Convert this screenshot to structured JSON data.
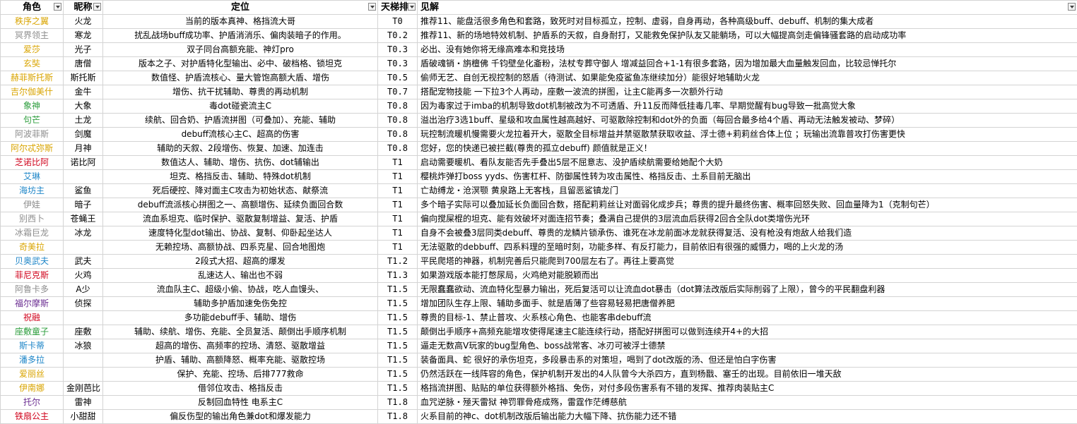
{
  "headers": [
    "角色",
    "昵称",
    "定位",
    "天梯排",
    "见解"
  ],
  "rows": [
    {
      "name": "秩序之翼",
      "color": "#d9a400",
      "nick": "火龙",
      "role": "当前的版本真神、格挡流大哥",
      "tier": "T0",
      "note": "推荐11、能盘活很多角色和套路，致死时对目标孤立，控制、虚弱，自身再动，各种高级buff、debuff、机制的集大成者"
    },
    {
      "name": "冥界领主",
      "color": "#8c8c8c",
      "nick": "寒龙",
      "role": "扰乱战场buff成功率、护盾消消乐、偏肉装暗子的作用。",
      "tier": "T0.2",
      "note": "推荐11、新的场地特效机制、护盾系的天叙，自身耐打，又能救免保护队友又能躺场，可以大幅提高剑走偏锋骚套路的启动成功率"
    },
    {
      "name": "爱莎",
      "color": "#d9a400",
      "nick": "光子",
      "role": "双子同台高额充能、神灯pro",
      "tier": "T0.3",
      "note": "必出、没有她你将无缘高难本和竞技场"
    },
    {
      "name": "玄奘",
      "color": "#d9a400",
      "nick": "唐僧",
      "role": "版本之子、对护盾特化型输出、必中、破档格、锁坦克",
      "tier": "T0.3",
      "note": "盾破魂销・旃檀佛  千钧壁垒化齑粉，法杖专葬守御人   增减益回合+1-1有很多套路，因为增加最大血量触发回血，比较忌惮托尔"
    },
    {
      "name": "赫菲斯托斯",
      "color": "#d9a400",
      "nick": "斯托斯",
      "role": "数值怪、护盾流核心、量大管饱高额大盾、增伤",
      "tier": "T0.5",
      "note": "偷师无艺、自创无视控制的怒盾（待测试、如果能免疫鲨鱼冻继续加分）能很好地辅助火龙"
    },
    {
      "name": "吉尔伽美什",
      "color": "#d9a400",
      "nick": "金牛",
      "role": "增伤、抗干扰辅助、尊贵的再动机制",
      "tier": "T0.7",
      "note": "搭配宠物技能  一下拉3个人再动，座敷一波流的拼图，让主C能再多一次额外行动"
    },
    {
      "name": "象神",
      "color": "#2e9e3e",
      "nick": "大象",
      "role": "毒dot碰瓷流主C",
      "tier": "T0.8",
      "note": "因为毒家过于imba的机制导致dot机制被改为不可透盾、升11反而降低挂毒几率、早期觉醒有bug导致一批高觉大象"
    },
    {
      "name": "句芒",
      "color": "#2e9e3e",
      "nick": "土龙",
      "role": "续航、回合奶、护盾流拼图（可叠加）、充能、辅助",
      "tier": "T0.8",
      "note": "溢出治疗3选1buff、星级和攻血属性越高越好、可驱散除控制和dot外的负面（每回合最多给4个盾、再动无法触发被动、梦碎）"
    },
    {
      "name": "阿波菲斯",
      "color": "#8c8c8c",
      "nick": "剑魔",
      "role": "debuff流核心主C、超高的伤害",
      "tier": "T0.8",
      "note": "玩控制流暖机慢需要火龙拉着开大，驱散全目标增益并禁驱散禁获取收益、浮士德+莉莉丝合体上位 ；玩输出流靠普攻打伤害更快"
    },
    {
      "name": "阿尔忒弥斯",
      "color": "#d9a400",
      "nick": "月神",
      "role": "辅助的天叙、2段增伤、恢复、加速、加连击",
      "tier": "T0.8",
      "note": "您好，您的快递已被拦截(尊贵的孤立debuff) 颜值就是正义！"
    },
    {
      "name": "芝诺比阿",
      "color": "#d0021b",
      "nick": "诺比阿",
      "role": "数值达人、辅助、增伤、抗伤、dot辅输出",
      "tier": "T1",
      "note": "启动需要暖机、看队友能否先手叠出5层不屈意志、没护盾续航需要给她配个大奶"
    },
    {
      "name": "艾琳",
      "color": "#1f86c8",
      "nick": "",
      "role": "坦克、格挡反击、辅助、特殊dot机制",
      "tier": "T1",
      "note": "樱桃炸弹打boss yyds、伤害杠杆、防御属性转为攻击属性、格挡反击、土系目前无脑出"
    },
    {
      "name": "海坊主",
      "color": "#1f86c8",
      "nick": "鲨鱼",
      "role": "死后硬控、降对面主C攻击为初始状态、献祭流",
      "tier": "T1",
      "note": "亡劫缚龙・沧溟颚 黄泉路上无客栈，且留恶鲨镇龙门"
    },
    {
      "name": "伊娃",
      "color": "#8c8c8c",
      "nick": "暗子",
      "role": "debuff流派核心拼图之一、高额增伤、延续负面回合数",
      "tier": "T1",
      "note": "多个暗子实际可以叠加延长负面回合数，搭配莉莉丝让对面弱化成步兵；尊贵的提升最终伤害、概率回怒失败、回血量降为1（克制句芒）"
    },
    {
      "name": "别西卜",
      "color": "#8c8c8c",
      "nick": "苍蝇王",
      "role": "流血系坦克、临时保护、驱散复制增益、复活、护盾",
      "tier": "T1",
      "note": "偏向搅屎棍的坦克、能有效破坏对面连招节奏；叠满自己提供的3层流血后获得2回合全队dot类增伤光环"
    },
    {
      "name": "冰霜巨龙",
      "color": "#8c8c8c",
      "nick": "冰龙",
      "role": "速度特化型dot输出、协战、复制、仰卧起坐达人",
      "tier": "T1",
      "note": "自身不会被叠3层同类debuff、尊贵的龙鳞片锁承伤、谁死在冰龙前面冰龙就获得复活、没有枪没有炮敌人给我们造"
    },
    {
      "name": "奇美拉",
      "color": "#d9a400",
      "nick": "",
      "role": "无赖控场、高额协战、四系克星、回合地图炮",
      "tier": "T1",
      "note": "无法驱散的debbuff、四系料理的至暗时刻，功能多样、有反打能力，目前依旧有很强的威慑力，喝的上火龙的汤"
    },
    {
      "name": "贝奥武夫",
      "color": "#1f86c8",
      "nick": "武夫",
      "role": "2段式大招、超高的爆发",
      "tier": "T1.2",
      "note": "平民爬塔的神器，机制完善后只能爬到700层左右了。再往上要高觉"
    },
    {
      "name": "菲尼克斯",
      "color": "#d0021b",
      "nick": "火鸡",
      "role": "乱速达人、输出也不弱",
      "tier": "T1.3",
      "note": "如果游戏版本能打憋尿局，火鸡绝对能脱颖而出"
    },
    {
      "name": "阿鲁卡多",
      "color": "#8c8c8c",
      "nick": "A少",
      "role": "流血队主C、超级小偷、协战，吃人血馒头、",
      "tier": "T1.5",
      "note": "无限蠢蠢欲动、流血特化型暴力输出，死后复活可以让流血dot暴击（dot算法改版后实际削弱了上限），曾今的平民翻盘利器"
    },
    {
      "name": "福尔摩斯",
      "color": "#6a2c91",
      "nick": "侦探",
      "role": "辅助多护盾加速免伤免控",
      "tier": "T1.5",
      "note": "增加团队生存上限、辅助多面手、就是盾薄了些容易轻易把唐僧养肥"
    },
    {
      "name": "祝融",
      "color": "#d0021b",
      "nick": "",
      "role": "多功能debuff手、辅助、增伤",
      "tier": "T1.5",
      "note": "尊贵的目标-1、禁止普攻、火系核心角色、也能客串debuff流"
    },
    {
      "name": "座敷童子",
      "color": "#2e9e3e",
      "nick": "座敷",
      "role": "辅助、续航、增伤、充能、全员复活、颠倒出手顺序机制",
      "tier": "T1.5",
      "note": "颠倒出手顺序+高频充能增攻使得尾速主C能连续行动，搭配好拼图可以做到连续开4+的大招"
    },
    {
      "name": "斯卡蒂",
      "color": "#1f86c8",
      "nick": "冰狼",
      "role": "超高的增伤、高频率的控场、清怒、驱散增益",
      "tier": "T1.5",
      "note": "逼走无数高V玩家的bug型角色、boss战常客、冰刃可被浮士德禁"
    },
    {
      "name": "潘多拉",
      "color": "#1f86c8",
      "nick": "",
      "role": "护盾、辅助、高额降怒、概率充能、驱散控场",
      "tier": "T1.5",
      "note": "装备面具、蛇 很好的承伤坦克，多段暴击系的对策坦，喝到了dot改版的汤、但还是怕白字伤害"
    },
    {
      "name": "爱丽丝",
      "color": "#d9a400",
      "nick": "",
      "role": "保护、充能、控场、后排777救命",
      "tier": "T1.5",
      "note": "仍然活跃在一线阵容的角色，保护机制开发出的4人队曾今大杀四方，直到杨戬、塞壬的出现。目前依旧一堆天敌"
    },
    {
      "name": "伊南娜",
      "color": "#d9a400",
      "nick": "金刚芭比",
      "role": "借邻位攻击、格挡反击",
      "tier": "T1.5",
      "note": "格挡流拼图、贴贴的单位获得额外格挡、免伤，对付多段伤害系有不错的发挥、推荐肉装贴主C"
    },
    {
      "name": "托尔",
      "color": "#6a2c91",
      "nick": "雷神",
      "role": "反制回血特性  电系主C",
      "tier": "T1.8",
      "note": "血咒逆脉・殛天雷狱   神罚罪骨疮成殇，雷霆作茫缚慈航"
    },
    {
      "name": "铁扇公主",
      "color": "#d0021b",
      "nick": "小甜甜",
      "role": "偏反伤型的输出角色兼dot和爆发能力",
      "tier": "T1.8",
      "note": "火系目前的神c、dot机制改版后输出能力大幅下降、抗伤能力还不错"
    }
  ]
}
